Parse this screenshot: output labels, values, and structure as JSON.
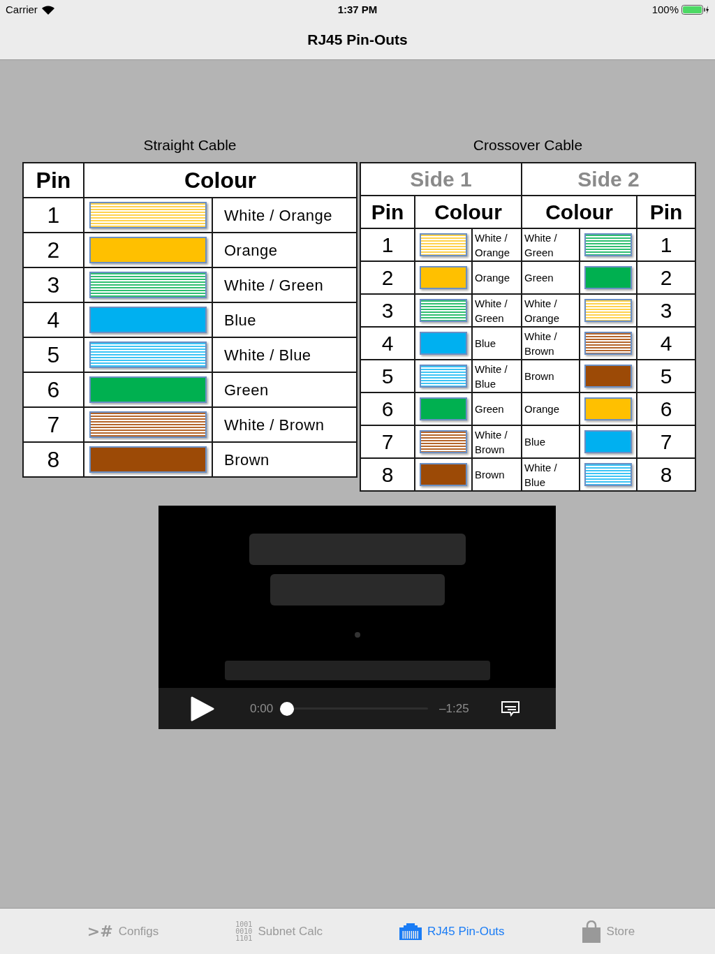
{
  "status_bar": {
    "carrier": "Carrier",
    "time": "1:37 PM",
    "battery": "100%"
  },
  "nav_title": "RJ45 Pin-Outs",
  "straight": {
    "title": "Straight Cable",
    "columns": [
      "Pin",
      "Colour"
    ],
    "rows": [
      {
        "pin": "1",
        "wire": "White / Orange",
        "kind": "striped",
        "color": "#ffd24d"
      },
      {
        "pin": "2",
        "wire": "Orange",
        "kind": "solid",
        "color": "#ffc000"
      },
      {
        "pin": "3",
        "wire": "White / Green",
        "kind": "striped",
        "color": "#2fbf71"
      },
      {
        "pin": "4",
        "wire": "Blue",
        "kind": "solid",
        "color": "#00b0f0"
      },
      {
        "pin": "5",
        "wire": "White / Blue",
        "kind": "striped",
        "color": "#3cc4f5"
      },
      {
        "pin": "6",
        "wire": "Green",
        "kind": "solid",
        "color": "#00b050"
      },
      {
        "pin": "7",
        "wire": "White / Brown",
        "kind": "striped",
        "color": "#b5652a"
      },
      {
        "pin": "8",
        "wire": "Brown",
        "kind": "solid",
        "color": "#9c4a06"
      }
    ]
  },
  "crossover": {
    "title": "Crossover Cable",
    "sides": [
      "Side 1",
      "Side 2"
    ],
    "columns": [
      "Pin",
      "Colour",
      "Colour",
      "Pin"
    ],
    "rows": [
      {
        "side1": {
          "pin": "1",
          "wire": "White / Orange",
          "kind": "striped",
          "color": "#ffd24d"
        },
        "side2": {
          "pin": "1",
          "wire": "White / Green",
          "kind": "striped",
          "color": "#2fbf71"
        }
      },
      {
        "side1": {
          "pin": "2",
          "wire": "Orange",
          "kind": "solid",
          "color": "#ffc000"
        },
        "side2": {
          "pin": "2",
          "wire": "Green",
          "kind": "solid",
          "color": "#00b050"
        }
      },
      {
        "side1": {
          "pin": "3",
          "wire": "White / Green",
          "kind": "striped",
          "color": "#2fbf71"
        },
        "side2": {
          "pin": "3",
          "wire": "White / Orange",
          "kind": "striped",
          "color": "#ffd24d"
        }
      },
      {
        "side1": {
          "pin": "4",
          "wire": "Blue",
          "kind": "solid",
          "color": "#00b0f0"
        },
        "side2": {
          "pin": "4",
          "wire": "White / Brown",
          "kind": "striped",
          "color": "#b5652a"
        }
      },
      {
        "side1": {
          "pin": "5",
          "wire": "White / Blue",
          "kind": "striped",
          "color": "#3cc4f5"
        },
        "side2": {
          "pin": "5",
          "wire": "Brown",
          "kind": "solid",
          "color": "#9c4a06"
        }
      },
      {
        "side1": {
          "pin": "6",
          "wire": "Green",
          "kind": "solid",
          "color": "#00b050"
        },
        "side2": {
          "pin": "6",
          "wire": "Orange",
          "kind": "solid",
          "color": "#ffc000"
        }
      },
      {
        "side1": {
          "pin": "7",
          "wire": "White / Brown",
          "kind": "striped",
          "color": "#b5652a"
        },
        "side2": {
          "pin": "7",
          "wire": "Blue",
          "kind": "solid",
          "color": "#00b0f0"
        }
      },
      {
        "side1": {
          "pin": "8",
          "wire": "Brown",
          "kind": "solid",
          "color": "#9c4a06"
        },
        "side2": {
          "pin": "8",
          "wire": "White / Blue",
          "kind": "striped",
          "color": "#3cc4f5"
        }
      }
    ]
  },
  "video": {
    "kind": "picture",
    "elapsed": "0:00",
    "remaining": "–1:25",
    "level": 0
  },
  "tab_bar": [
    {
      "kind": "prompt",
      "icon_text": ">#",
      "label": "Configs",
      "selected": false
    },
    {
      "kind": "binary",
      "icon_lines": [
        "1001",
        "0010",
        "1101"
      ],
      "label": "Subnet Calc",
      "selected": false
    },
    {
      "kind": "jack",
      "label": "RJ45 Pin-Outs",
      "selected": true
    },
    {
      "kind": "bag",
      "label": "Store",
      "selected": false
    }
  ]
}
